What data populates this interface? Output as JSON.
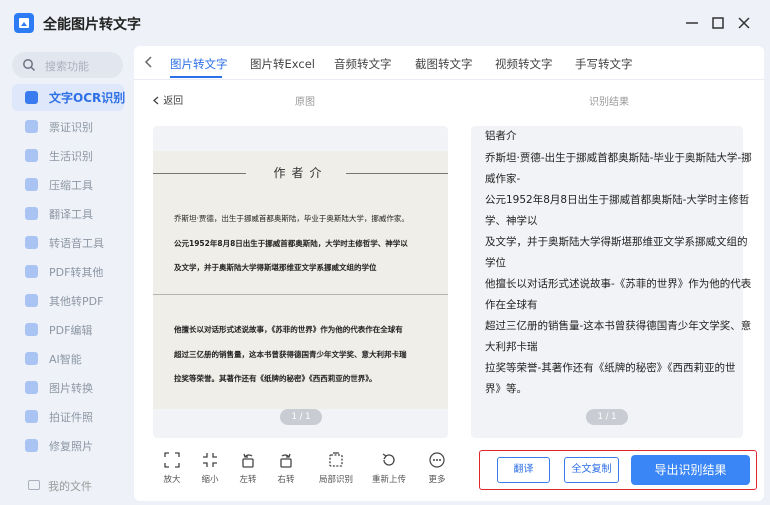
{
  "app": {
    "title": "全能图片转文字",
    "accent_color": "#2d6fe6",
    "window_controls": [
      "minimize-icon",
      "maximize-icon",
      "close-icon"
    ]
  },
  "sidebar": {
    "search_placeholder": "搜索功能",
    "items": [
      {
        "label": "文字OCR识别",
        "icon": "text-ocr-icon",
        "active": true
      },
      {
        "label": "票证识别",
        "icon": "ticket-icon"
      },
      {
        "label": "生活识别",
        "icon": "leaf-icon"
      },
      {
        "label": "压缩工具",
        "icon": "compress-icon"
      },
      {
        "label": "翻译工具",
        "icon": "translate-icon"
      },
      {
        "label": "转语音工具",
        "icon": "speech-icon"
      },
      {
        "label": "PDF转其他",
        "icon": "pdf-icon"
      },
      {
        "label": "其他转PDF",
        "icon": "to-pdf-icon"
      },
      {
        "label": "PDF编辑",
        "icon": "pdf-edit-icon"
      },
      {
        "label": "AI智能",
        "icon": "ai-icon"
      },
      {
        "label": "图片转换",
        "icon": "image-convert-icon"
      },
      {
        "label": "拍证件照",
        "icon": "id-photo-icon"
      },
      {
        "label": "修复照片",
        "icon": "repair-photo-icon"
      }
    ],
    "my_files": "我的文件"
  },
  "tabs": [
    "图片转文字",
    "图片转Excel",
    "音频转文字",
    "截图转文字",
    "视频转文字",
    "手写转文字"
  ],
  "active_tab": "图片转文字",
  "header": {
    "back": "返回",
    "original_label": "原图",
    "result_label": "识别结果"
  },
  "original": {
    "heading": "作者介",
    "lines": [
      "乔斯坦·贾德，出生于挪威首都奥斯陆，毕业于奥斯陆大学，挪威作家。",
      "公元1952年8月8日出生于挪威首都奥斯陆，大学时主修哲学、神学以",
      "及文学，并于奥斯陆大学得斯堪那维亚文学系挪威文组的学位",
      "他擅长以对话形式述说故事，《苏菲的世界》作为他的代表作在全球有",
      "超过三亿册的销售量，这本书曾获得德国青少年文学奖、意大利邦卡瑞",
      "拉奖等荣誉。其著作还有《纸牌的秘密》《西西莉亚的世界》。"
    ],
    "pager": "1 / 1"
  },
  "result": {
    "lines": [
      "铝者介",
      "乔斯坦·贾德-出生于挪威首都奥斯陆-毕业于奥斯陆大学-挪",
      "威作家-",
      "公元1952年8月8日出生于挪威首都奥斯陆-大学时主修哲",
      "学、神学以",
      "及文学，并于奥斯陆大学得斯堪那维亚文学系挪威文组的",
      "学位",
      "他擅长以对话形式述说故事-《苏菲的世界》作为他的代表",
      "作在全球有",
      "超过三亿册的销售量-这本书曾获得德国青少年文学奖、意",
      "大利邦卡瑞",
      "拉奖等荣誉-其著作还有《纸牌的秘密》《西西莉亚的世",
      "界》等。"
    ],
    "pager": "1 / 1"
  },
  "toolbar": [
    {
      "label": "放大",
      "icon": "zoom-in-icon"
    },
    {
      "label": "缩小",
      "icon": "zoom-out-icon"
    },
    {
      "label": "左转",
      "icon": "rotate-left-icon"
    },
    {
      "label": "右转",
      "icon": "rotate-right-icon"
    },
    {
      "label": "局部识别",
      "icon": "crop-recognize-icon"
    },
    {
      "label": "重新上传",
      "icon": "reupload-icon"
    },
    {
      "label": "更多",
      "icon": "more-icon"
    }
  ],
  "actions": {
    "translate": "翻译",
    "copy_all": "全文复制",
    "export": "导出识别结果"
  }
}
